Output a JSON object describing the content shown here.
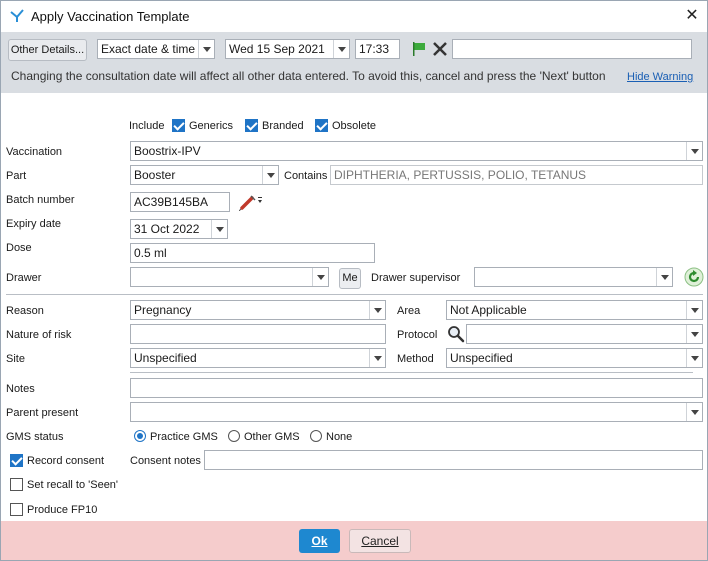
{
  "window": {
    "title": "Apply Vaccination Template",
    "app_icon": "vaccine-app-icon",
    "close_icon": "close-icon"
  },
  "toolbar": {
    "other_details_label": "Other Details...",
    "date_mode": "Exact date & time",
    "date": "Wed 15 Sep 2021",
    "time": "17:33",
    "flag_icon": "flag-icon",
    "clear_icon": "clear-x-icon",
    "free_text": ""
  },
  "warning": {
    "message": "Changing the consultation date will affect all other data entered. To avoid this, cancel and press the 'Next' button",
    "hide_link": "Hide Warning"
  },
  "include": {
    "label": "Include",
    "options": [
      {
        "label": "Generics",
        "checked": true
      },
      {
        "label": "Branded",
        "checked": true
      },
      {
        "label": "Obsolete",
        "checked": true
      }
    ]
  },
  "form": {
    "vaccination": {
      "label": "Vaccination",
      "value": "Boostrix-IPV"
    },
    "part": {
      "label": "Part",
      "value": "Booster"
    },
    "contains": {
      "label": "Contains",
      "value": "DIPHTHERIA, PERTUSSIS, POLIO, TETANUS"
    },
    "batch": {
      "label": "Batch number",
      "value": "AC39B145BA",
      "icon": "syringe-icon"
    },
    "expiry": {
      "label": "Expiry date",
      "value": "31 Oct 2022"
    },
    "dose": {
      "label": "Dose",
      "value": "0.5 ml"
    },
    "drawer": {
      "label": "Drawer",
      "value": "",
      "me_label": "Me"
    },
    "drawer_supervisor": {
      "label": "Drawer supervisor",
      "value": "",
      "icon": "refresh-icon"
    },
    "reason": {
      "label": "Reason",
      "value": "Pregnancy"
    },
    "area": {
      "label": "Area",
      "value": "Not Applicable"
    },
    "nature_of_risk": {
      "label": "Nature of risk",
      "value": ""
    },
    "protocol": {
      "label": "Protocol",
      "value": "",
      "icon": "search-icon"
    },
    "site": {
      "label": "Site",
      "value": "Unspecified"
    },
    "method": {
      "label": "Method",
      "value": "Unspecified"
    },
    "notes": {
      "label": "Notes",
      "value": ""
    },
    "parent_present": {
      "label": "Parent present",
      "value": ""
    },
    "gms_status": {
      "label": "GMS status",
      "options": [
        {
          "label": "Practice GMS",
          "selected": true
        },
        {
          "label": "Other GMS",
          "selected": false
        },
        {
          "label": "None",
          "selected": false
        }
      ]
    },
    "record_consent": {
      "label": "Record consent",
      "checked": true
    },
    "consent_notes": {
      "label": "Consent notes",
      "value": ""
    },
    "set_recall": {
      "label": "Set recall to 'Seen'",
      "checked": false
    },
    "produce_fp10": {
      "label": "Produce FP10",
      "checked": false
    }
  },
  "footer": {
    "ok_label": "Ok",
    "cancel_label": "Cancel"
  },
  "colors": {
    "accent": "#1e88d0",
    "footer_bg": "#f5cccc",
    "warning_bg": "#d9dde2"
  }
}
